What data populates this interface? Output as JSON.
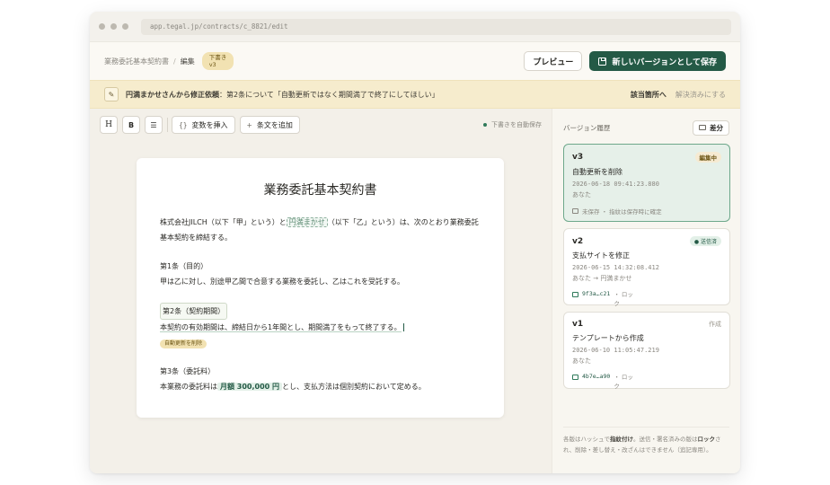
{
  "browser": {
    "url": "app.tegal.jp/contracts/c_8821/edit"
  },
  "header": {
    "breadcrumb_root": "業務委託基本契約書",
    "breadcrumb_sep": "/",
    "breadcrumb_current": "編集",
    "draft_badge_line1": "下書き",
    "draft_badge_line2": "v3",
    "preview_label": "プレビュー",
    "save_label": "新しいバージョンとして保存"
  },
  "banner": {
    "requester": "円満まかせさんから修正依頼",
    "message": "：第2条について「自動更新ではなく期間満了で終了にしてほしい」",
    "goto_label": "該当箇所へ",
    "resolve_label": "解決済みにする"
  },
  "toolbar": {
    "h_label": "H",
    "b_label": "B",
    "list_glyph": "☰",
    "var_glyph": "{}",
    "var_label": "変数を挿入",
    "clause_glyph": "+",
    "clause_label": "条文を追加",
    "autosave_label": "下書きを自動保存"
  },
  "document": {
    "title": "業務委託基本契約書",
    "intro_a": "株式会社JILCH（以下「甲」という）と",
    "intro_var": "円満まかせ",
    "intro_b": "（以下「乙」という）は、次のとおり業務委託基本契約を締結する。",
    "art1_heading": "第1条（目的）",
    "art1_body": "甲は乙に対し、別途甲乙間で合意する業務を委託し、乙はこれを受託する。",
    "art2_heading": "第2条（契約期間）",
    "art2_body": "本契約の有効期間は、締結日から1年間とし、期間満了をもって終了する。",
    "art2_tag": "自動更新を削除",
    "art3_heading": "第3条（委託料）",
    "art3_a": "本業務の委託料は",
    "art3_money": "月額 300,000 円",
    "art3_b": "とし、支払方法は個別契約において定める。"
  },
  "sidebar": {
    "title": "バージョン履歴",
    "diff_label": "差分",
    "versions": [
      {
        "version": "v3",
        "status": "編集中",
        "title": "自動更新を削除",
        "timestamp": "2026-06-18 09:41:23.880",
        "author": "あなた",
        "meta": "未保存 ・ 指紋は保存時に確定"
      },
      {
        "version": "v2",
        "status": "● 送信済",
        "title": "支払サイトを修正",
        "timestamp": "2026-06-15 14:32:08.412",
        "author": "あなた → 円満まかせ",
        "hash": "9f3a…c21",
        "lock": "・ ロック"
      },
      {
        "version": "v1",
        "status": "作成",
        "title": "テンプレートから作成",
        "timestamp": "2026-06-10 11:05:47.219",
        "author": "あなた",
        "hash": "4b7e…a90",
        "lock": "・ ロック"
      }
    ],
    "footer_a": "各版はハッシュで",
    "footer_b1": "指紋付け",
    "footer_c": "。送信・署名済みの版は",
    "footer_b2": "ロック",
    "footer_d": "され、削除・差し替え・改ざんはできません（追記専用）。"
  },
  "colors": {
    "accent": "#245a46",
    "banner": "#f6eccd",
    "badge": "#f2e2b2"
  }
}
